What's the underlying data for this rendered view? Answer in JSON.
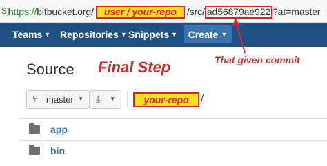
{
  "urlbar": {
    "secure_icon": "S]",
    "scheme": "https://",
    "host": "bitbucket.org/",
    "user_repo_highlight": "user / your-repo",
    "path_mid": "/src/",
    "commit_hash": "ad56879ae922",
    "query": "?at=master"
  },
  "nav": {
    "items": [
      {
        "label": "Teams"
      },
      {
        "label": "Repositories"
      },
      {
        "label": "Snippets"
      }
    ],
    "create_label": "Create",
    "background": "#205081",
    "create_background": "#3b73af"
  },
  "annotation": {
    "commit_label": "That given commit",
    "color": "#d32a2a"
  },
  "page": {
    "title": "Source",
    "annotation_title": "Final Step"
  },
  "toolbar": {
    "branch": "master",
    "branch_icon": "branch-icon",
    "download_icon": "download-icon",
    "repo_highlight": "your-repo",
    "path_separator": "/"
  },
  "files": [
    {
      "name": "app",
      "icon": "folder-icon"
    },
    {
      "name": "bin",
      "icon": "folder-icon"
    }
  ]
}
